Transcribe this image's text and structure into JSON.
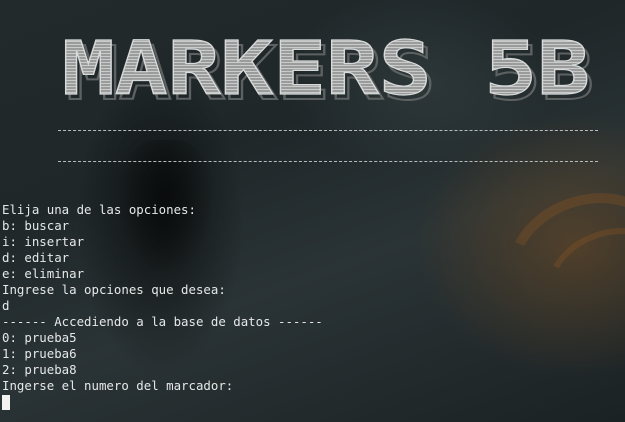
{
  "banner": {
    "title": "MARKERS 5B"
  },
  "terminal": {
    "lines": [
      "Elija una de las opciones:",
      "b: buscar",
      "i: insertar",
      "d: editar",
      "e: eliminar",
      "Ingrese la opciones que desea:",
      "d",
      "------ Accediendo a la base de datos ------",
      "0: prueba5",
      "1: prueba6",
      "2: prueba8",
      "Ingerse el numero del marcador:"
    ],
    "text_color": "#e6e8e8",
    "cursor_color": "#f2f2f2"
  }
}
